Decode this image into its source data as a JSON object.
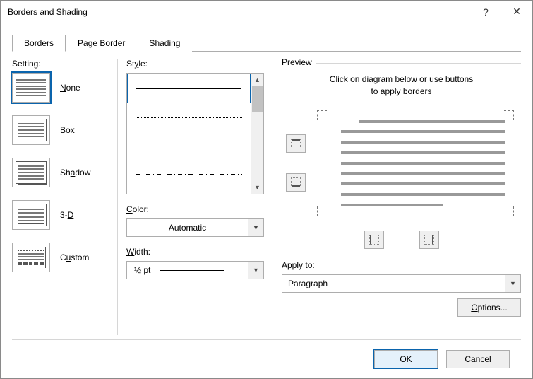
{
  "window": {
    "title": "Borders and Shading",
    "help_icon": "?",
    "close_icon": "✕"
  },
  "tabs": {
    "borders": "Borders",
    "page_border": "Page Border",
    "shading": "Shading"
  },
  "setting": {
    "label": "Setting:",
    "none": "None",
    "box": "Box",
    "shadow": "Shadow",
    "three_d": "3-D",
    "custom": "Custom"
  },
  "style": {
    "label": "Style:"
  },
  "color": {
    "label": "Color:",
    "value": "Automatic"
  },
  "width": {
    "label": "Width:",
    "value": "½ pt"
  },
  "preview": {
    "legend": "Preview",
    "hint_line1": "Click on diagram below or use buttons",
    "hint_line2": "to apply borders"
  },
  "apply_to": {
    "label": "Apply to:",
    "value": "Paragraph"
  },
  "buttons": {
    "options": "Options...",
    "ok": "OK",
    "cancel": "Cancel"
  }
}
